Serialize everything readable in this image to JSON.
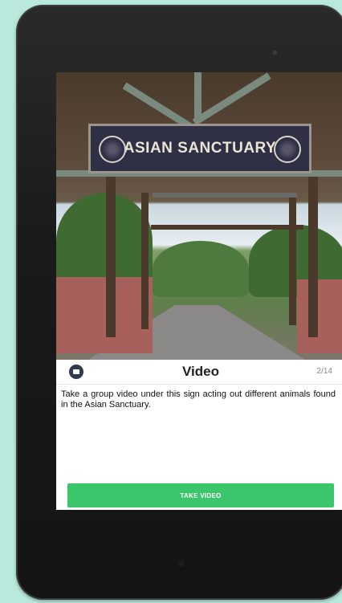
{
  "device": {
    "type": "tablet"
  },
  "photo": {
    "sign_text": "ASIAN SANCTUARY"
  },
  "card": {
    "type_label": "Video",
    "progress": "2/14",
    "description": "Take a group video under this sign acting out different animals found in the Asian Sanctuary.",
    "action_label": "TAKE VIDEO"
  },
  "colors": {
    "background": "#b9e9dd",
    "bezel": "#1a1a1a",
    "action_button": "#3cc66b",
    "icon_badge": "#2f3a4e"
  }
}
